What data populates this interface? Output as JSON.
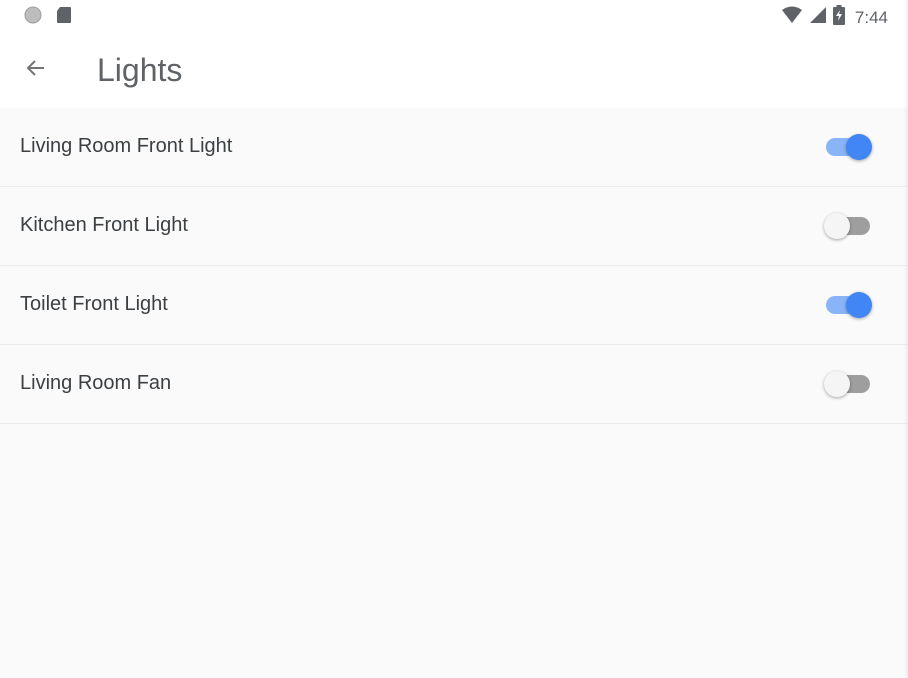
{
  "status_bar": {
    "time": "7:44",
    "left_icons": [
      "circle-icon",
      "sd-card-icon"
    ],
    "right_icons": [
      "wifi-icon",
      "cell-signal-icon",
      "battery-charging-icon"
    ]
  },
  "app_bar": {
    "title": "Lights",
    "back_icon": "arrow-back-icon"
  },
  "items": [
    {
      "label": "Living Room Front Light",
      "on": true
    },
    {
      "label": "Kitchen Front Light",
      "on": false
    },
    {
      "label": "Toilet Front Light",
      "on": true
    },
    {
      "label": "Living Room Fan",
      "on": false
    }
  ],
  "colors": {
    "switch_on_thumb": "#4285f4",
    "switch_on_track": "#8ab4f8",
    "switch_off_thumb": "#f5f5f5",
    "switch_off_track": "#9e9e9e"
  }
}
